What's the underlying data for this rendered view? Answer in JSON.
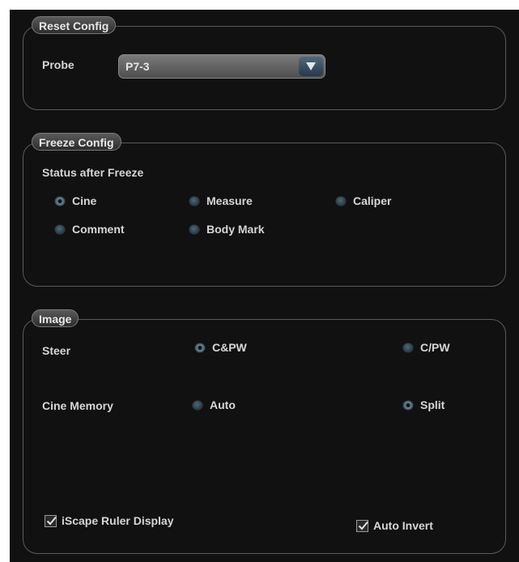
{
  "reset_config": {
    "title": "Reset Config",
    "probe_label": "Probe",
    "probe_value": "P7-3",
    "dropdown_icon": "chevron-down-icon"
  },
  "freeze_config": {
    "title": "Freeze Config",
    "status_label": "Status after Freeze",
    "options": [
      {
        "label": "Cine",
        "selected": true
      },
      {
        "label": "Measure",
        "selected": false
      },
      {
        "label": "Caliper",
        "selected": false
      },
      {
        "label": "Comment",
        "selected": false
      },
      {
        "label": "Body Mark",
        "selected": false
      }
    ]
  },
  "image": {
    "title": "Image",
    "steer": {
      "label": "Steer",
      "options": [
        {
          "label": "C&PW",
          "selected": true
        },
        {
          "label": "C/PW",
          "selected": false
        }
      ]
    },
    "cine_memory": {
      "label": "Cine Memory",
      "options": [
        {
          "label": "Auto",
          "selected": false
        },
        {
          "label": "Split",
          "selected": true
        }
      ]
    },
    "iscape_ruler": {
      "label": "iScape Ruler Display",
      "checked": true
    },
    "auto_invert": {
      "label": "Auto Invert",
      "checked": true
    }
  },
  "colors": {
    "panel_bg": "#111111",
    "group_border": "#5a5a5a",
    "text": "#d6d6d6",
    "radio_accent": "#4d6a78"
  }
}
